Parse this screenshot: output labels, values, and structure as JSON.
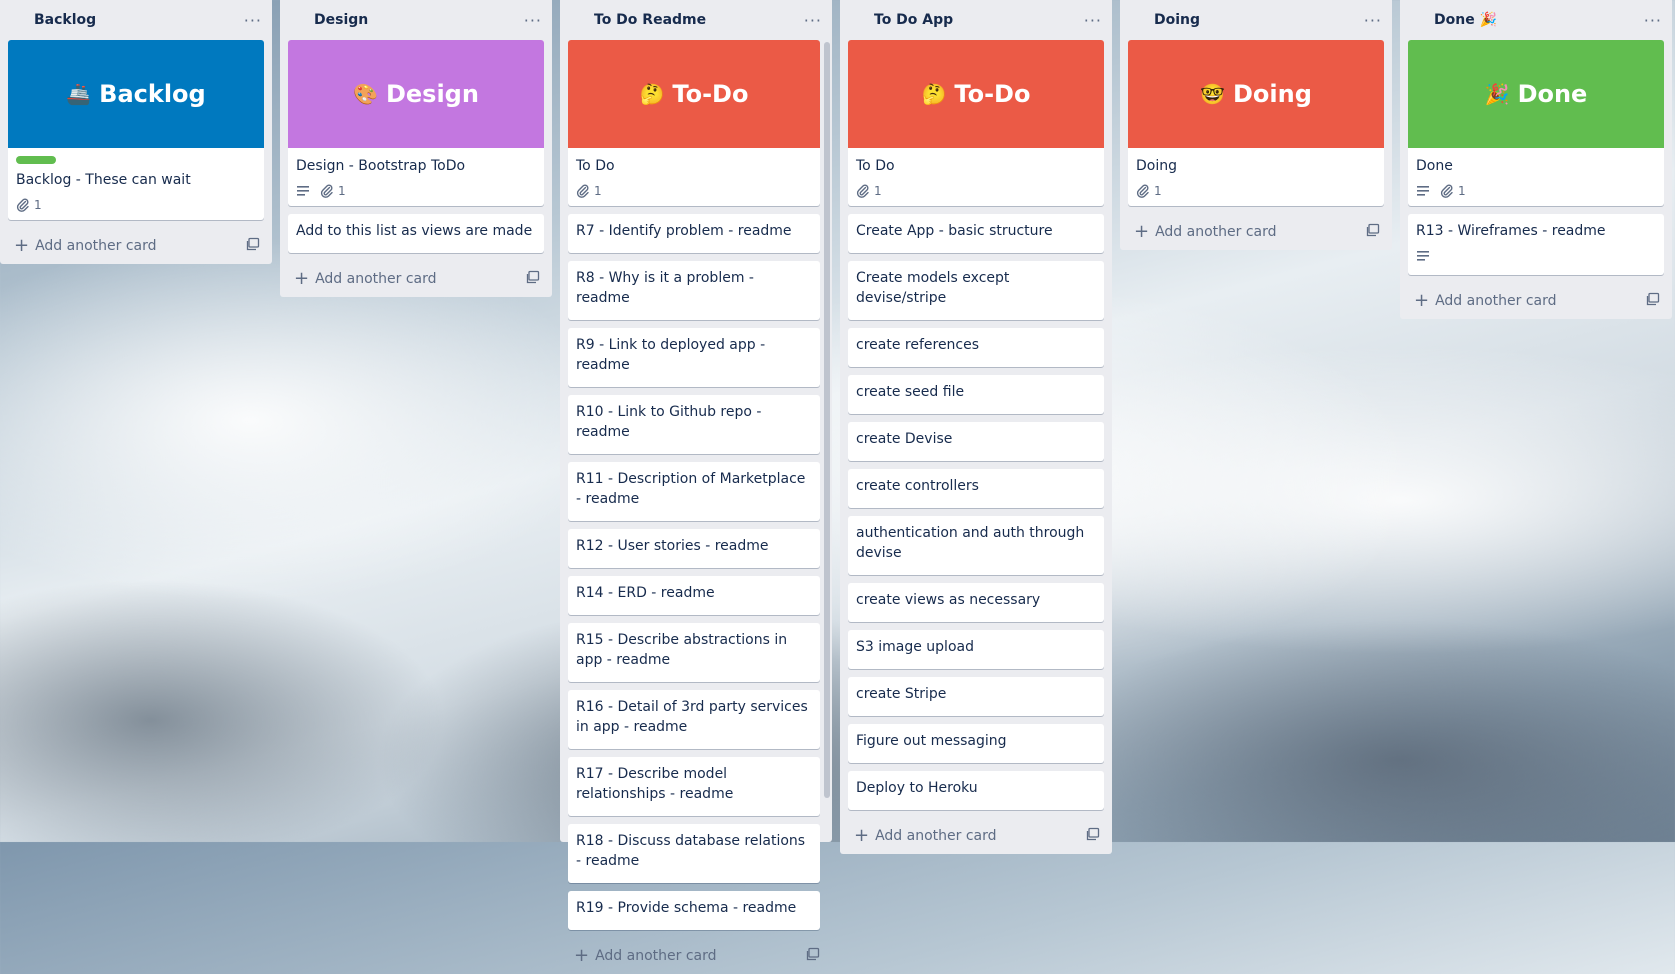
{
  "add_card_label": "Add another card",
  "colors": {
    "blue": "#0079bf",
    "purple": "#c377e0",
    "red": "#eb5a46",
    "green": "#61bd4f",
    "label_green": "#61bd4f"
  },
  "lists": [
    {
      "title": "Backlog",
      "menu": "···",
      "cover": {
        "emoji": "🚢",
        "text": "Backlog",
        "color": "#0079bf"
      },
      "first_card": {
        "label": "green",
        "title": "Backlog - These can wait",
        "description": false,
        "attachments": "1"
      },
      "cards": []
    },
    {
      "title": "Design",
      "menu": "···",
      "cover": {
        "emoji": "🎨",
        "text": "Design",
        "color": "#c377e0"
      },
      "first_card": {
        "title": "Design - Bootstrap ToDo",
        "description": true,
        "attachments": "1"
      },
      "cards": [
        "Add to this list as views are made"
      ]
    },
    {
      "title": "To Do Readme",
      "menu": "···",
      "cover": {
        "emoji": "🤔",
        "text": "To-Do",
        "color": "#eb5a46"
      },
      "first_card": {
        "title": "To Do",
        "description": false,
        "attachments": "1"
      },
      "cards": [
        "R7 - Identify problem - readme",
        "R8 - Why is it a problem - readme",
        "R9 - Link to deployed app - readme",
        "R10 - Link to Github repo - readme",
        "R11 - Description of Marketplace - readme",
        "R12 - User stories - readme",
        "R14 - ERD - readme",
        "R15 - Describe abstractions in app - readme",
        "R16 - Detail of 3rd party services in app - readme",
        "R17 - Describe model relationships - readme",
        "R18 - Discuss database relations - readme",
        "R19 - Provide schema - readme"
      ]
    },
    {
      "title": "To Do App",
      "menu": "···",
      "cover": {
        "emoji": "🤔",
        "text": "To-Do",
        "color": "#eb5a46"
      },
      "first_card": {
        "title": "To Do",
        "description": false,
        "attachments": "1"
      },
      "cards": [
        "Create App - basic structure",
        "Create models except devise/stripe",
        "create references",
        "create seed file",
        "create Devise",
        "create controllers",
        "authentication and auth through devise",
        "create views as necessary",
        "S3 image upload",
        "create Stripe",
        "Figure out messaging",
        "Deploy to Heroku"
      ]
    },
    {
      "title": "Doing",
      "menu": "···",
      "cover": {
        "emoji": "🤓",
        "text": "Doing",
        "color": "#eb5a46"
      },
      "first_card": {
        "title": "Doing",
        "description": false,
        "attachments": "1"
      },
      "cards": []
    },
    {
      "title": "Done 🎉",
      "menu": "···",
      "cover": {
        "emoji": "🎉",
        "text": "Done",
        "color": "#61bd4f"
      },
      "first_card": {
        "title": "Done",
        "description": true,
        "attachments": "1"
      },
      "cards": [],
      "desc_cards": [
        "R13 - Wireframes - readme"
      ]
    }
  ]
}
